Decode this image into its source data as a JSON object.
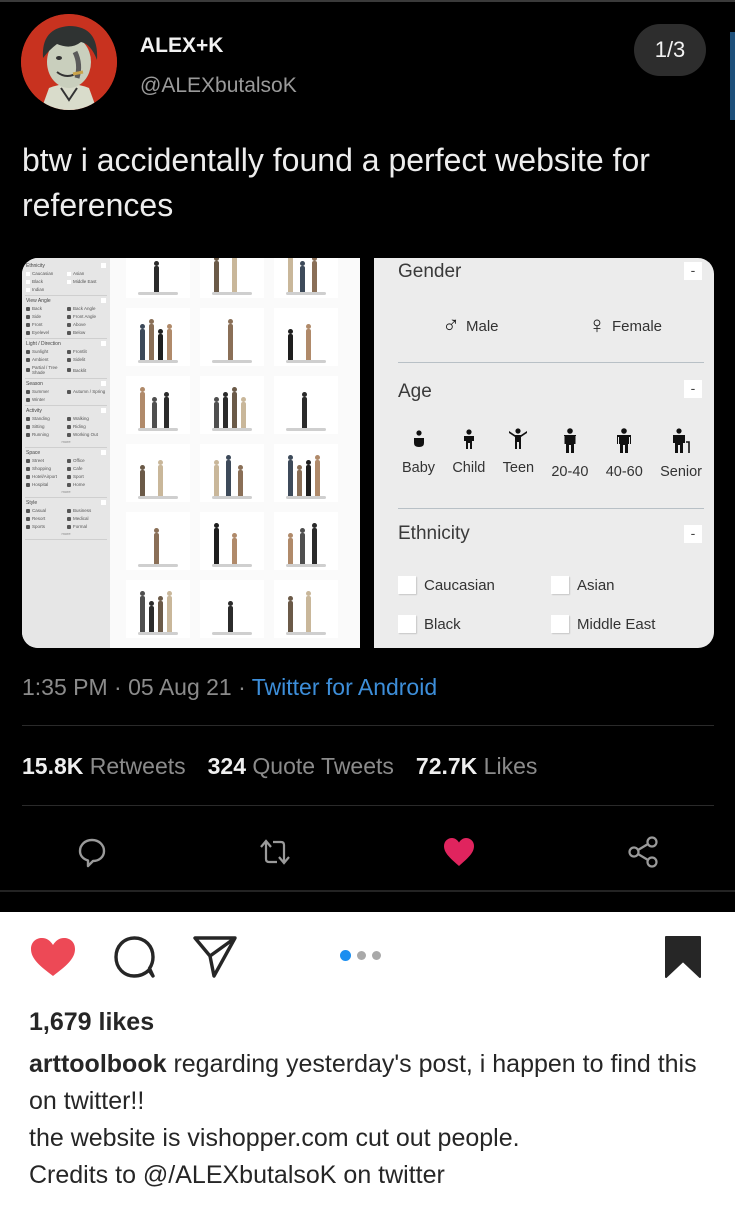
{
  "tweet": {
    "display_name": "ALEX+K",
    "handle": "@ALEXbutalsoK",
    "pager": "1/3",
    "text": "btw i accidentally found a perfect website for references",
    "time": "1:35 PM",
    "date": "05 Aug 21",
    "separator": "·",
    "source": "Twitter for Android",
    "stats": {
      "retweets_count": "15.8K",
      "retweets_label": "Retweets",
      "quotes_count": "324",
      "quotes_label": "Quote Tweets",
      "likes_count": "72.7K",
      "likes_label": "Likes"
    },
    "actions": [
      "reply-icon",
      "retweet-icon",
      "like-icon",
      "share-icon"
    ],
    "like_color": "#e0245e",
    "source_color": "#3d8ed9"
  },
  "website_screenshot": {
    "left": {
      "sections": [
        {
          "title": "Ethnicity",
          "items": [
            "Caucasian",
            "Asian",
            "Black",
            "Middle East",
            "Indian"
          ]
        },
        {
          "title": "View Angle",
          "items": [
            "Back",
            "Back Angle",
            "Side",
            "Front Angle",
            "Front",
            "Above",
            "Eyelevel",
            "Below"
          ]
        },
        {
          "title": "Light / Direction",
          "items": [
            "Sunlight",
            "Frontlit",
            "Ambient",
            "Sidelit",
            "Partial / Tree Shade",
            "Backlit"
          ]
        },
        {
          "title": "Season",
          "items": [
            "Summer",
            "Autumn / Spring",
            "Winter"
          ]
        },
        {
          "title": "Activity",
          "items": [
            "Standing",
            "Walking",
            "Sitting",
            "Riding",
            "Running",
            "Working Out"
          ],
          "more": "more"
        },
        {
          "title": "Space",
          "items": [
            "Street",
            "Office",
            "Shopping",
            "Cafe",
            "Hotel/Airport",
            "Sport",
            "Hospital",
            "Home"
          ],
          "more": "more"
        },
        {
          "title": "Style",
          "items": [
            "Casual",
            "Business",
            "Resort",
            "Medical",
            "Sports",
            "Formal"
          ],
          "more": "more"
        }
      ]
    },
    "right": {
      "gender": {
        "title": "Gender",
        "collapse": "-",
        "options": [
          {
            "symbol": "♂",
            "label": "Male"
          },
          {
            "symbol": "♀",
            "label": "Female"
          }
        ]
      },
      "age": {
        "title": "Age",
        "collapse": "-",
        "options": [
          "Baby",
          "Child",
          "Teen",
          "20-40",
          "40-60",
          "Senior"
        ]
      },
      "ethnicity": {
        "title": "Ethnicity",
        "collapse": "-",
        "options": [
          "Caucasian",
          "Asian",
          "Black",
          "Middle East"
        ]
      }
    }
  },
  "instagram": {
    "carousel": {
      "current": 1,
      "total": 3
    },
    "likes": "1,679 likes",
    "username": "arttoolbook",
    "caption_line1": "regarding yesterday's post, i happen to find this on twitter!!",
    "caption_line2": "the website is vishopper.com cut out people.",
    "caption_line3": "Credits to @/ALEXbutalsoK on twitter",
    "like_color": "#ed4956",
    "dot_active_color": "#1a8ef0"
  }
}
